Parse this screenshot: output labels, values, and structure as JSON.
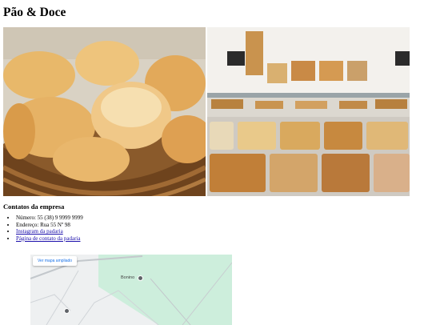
{
  "page": {
    "title": "Pão & Doce"
  },
  "contacts": {
    "heading": "Contatos da empresa",
    "phone": "Número: 55 (38) 9 9999 9999",
    "address": "Endereço: Rua 55 Nº 98",
    "instagram_link": "Instagram da padaria",
    "contact_link": "Página de contato da padaria"
  },
  "map": {
    "button_label": "Ver mapa ampliado",
    "place_label": "Bonino"
  },
  "colors": {
    "map_green": "#cdeedc",
    "link": "#1a0dab"
  }
}
